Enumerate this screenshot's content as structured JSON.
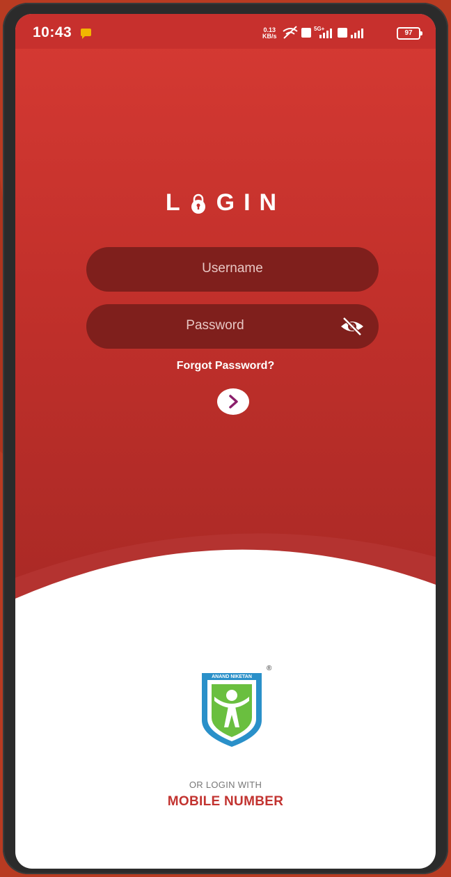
{
  "status_bar": {
    "time": "10:43",
    "net_speed_value": "0.13",
    "net_speed_unit": "KB/s",
    "battery": "97"
  },
  "login": {
    "title_left": "L",
    "title_right": "GIN",
    "username_placeholder": "Username",
    "password_placeholder": "Password",
    "forgot_label": "Forgot Password?"
  },
  "logo": {
    "text": "ANAND NIKETAN",
    "registered": "®"
  },
  "footer": {
    "or_login_with": "OR LOGIN WITH",
    "mobile_number": "MOBILE NUMBER"
  },
  "colors": {
    "brand_red": "#c7302d",
    "field_bg": "#7f1f1c",
    "link_red": "#c23330"
  },
  "icons": [
    "message-icon",
    "lock-icon",
    "eye-off-icon",
    "chevron-right-icon",
    "logo-emblem"
  ]
}
